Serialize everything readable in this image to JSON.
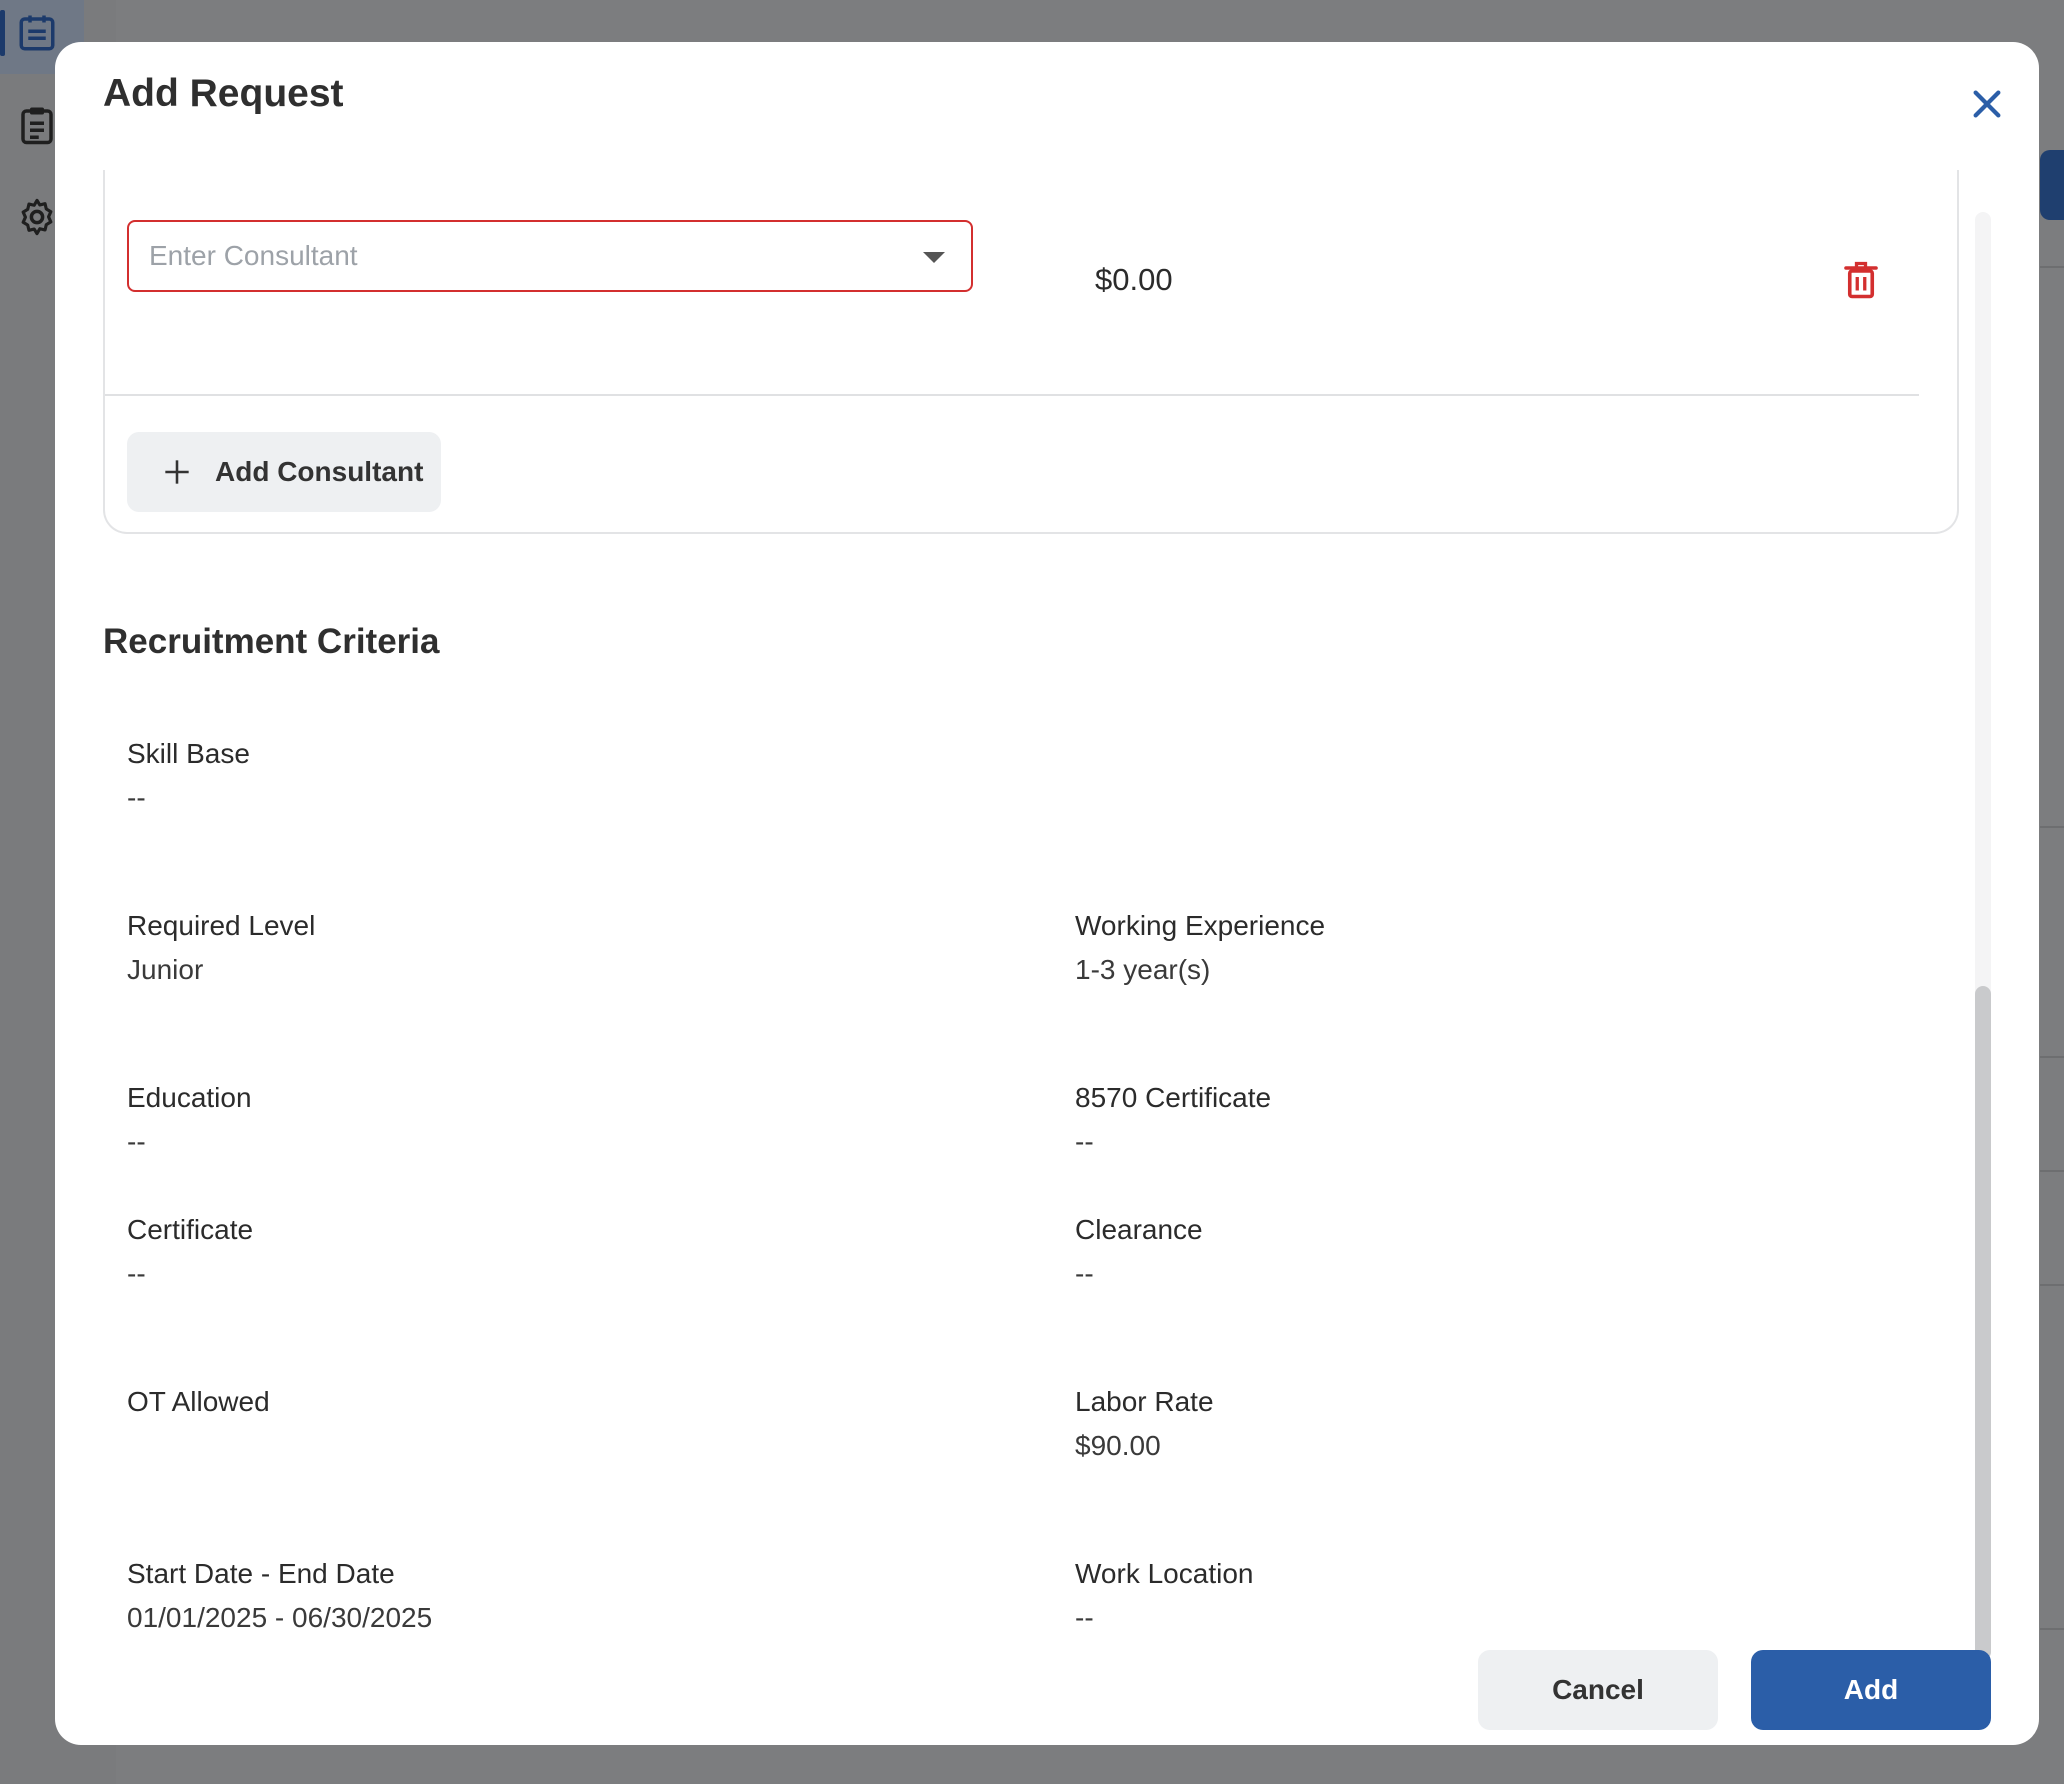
{
  "modal": {
    "title": "Add Request",
    "close_icon": "close-icon"
  },
  "consultant": {
    "select_placeholder": "Enter Consultant",
    "price": "$0.00",
    "add_label": "Add Consultant"
  },
  "criteria": {
    "title": "Recruitment Criteria",
    "skill_base": {
      "label": "Skill Base",
      "value": "--"
    },
    "required_level": {
      "label": "Required Level",
      "value": "Junior"
    },
    "working_experience": {
      "label": "Working Experience",
      "value": "1-3 year(s)"
    },
    "education": {
      "label": "Education",
      "value": "--"
    },
    "cert_8570": {
      "label": "8570 Certificate",
      "value": "--"
    },
    "certificate": {
      "label": "Certificate",
      "value": "--"
    },
    "clearance": {
      "label": "Clearance",
      "value": "--"
    },
    "ot_allowed": {
      "label": "OT Allowed",
      "value": ""
    },
    "labor_rate": {
      "label": "Labor Rate",
      "value": "$90.00"
    },
    "dates": {
      "label": "Start Date - End Date",
      "value": "01/01/2025 - 06/30/2025"
    },
    "work_location": {
      "label": "Work Location",
      "value": "--"
    }
  },
  "footer": {
    "cancel_label": "Cancel",
    "add_label": "Add"
  },
  "colors": {
    "primary": "#2b5ea8",
    "error": "#d32f2f"
  }
}
